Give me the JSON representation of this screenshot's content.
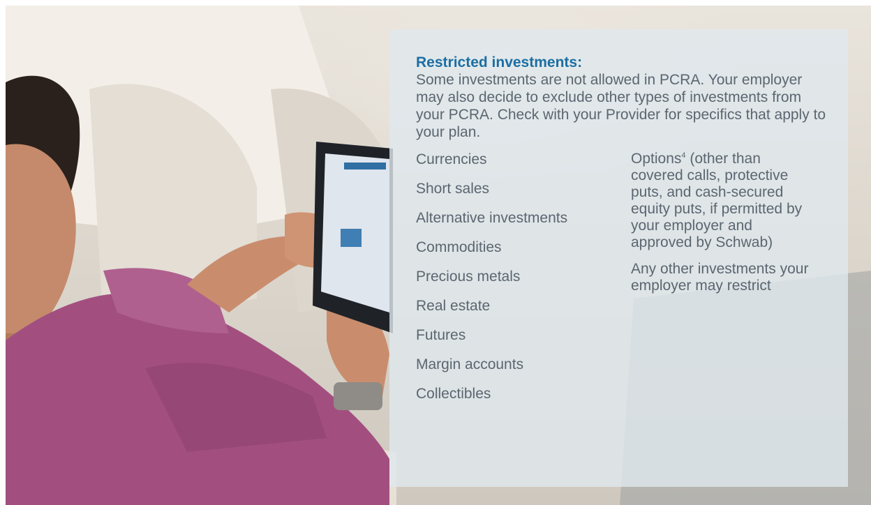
{
  "panel": {
    "heading": "Restricted investments:",
    "intro": "Some investments are not allowed in PCRA. Your employer may also decide to exclude other types of investments from your PCRA. Check with your Provider for specifics that apply to your plan.",
    "left_items": [
      "Currencies",
      "Short sales",
      "Alternative investments",
      "Commodities",
      "Precious metals",
      "Real estate",
      "Futures",
      "Margin accounts",
      "Collectibles"
    ],
    "options_label": "Options",
    "options_footnote": "4",
    "options_detail": " (other than covered calls, protective puts, and cash-secured equity puts, if permitted by your employer and approved by Schwab)",
    "any_other": "Any other investments your employer may restrict"
  },
  "photo": {
    "subject": "man-using-tablet",
    "shirt_color": "#a0507f",
    "skin_color": "#c98d6e",
    "sofa_color": "#ece7df"
  },
  "colors": {
    "heading": "#1c6ea3",
    "body_text": "#5b6670",
    "panel_bg": "#e0e8ee"
  }
}
